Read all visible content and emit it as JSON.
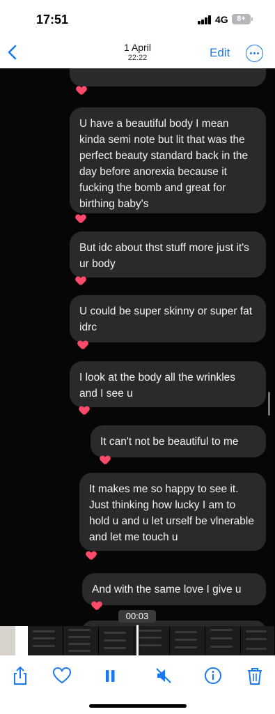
{
  "status_bar": {
    "time": "17:51",
    "network": "4G",
    "battery": "8+"
  },
  "nav": {
    "date": "1 April",
    "time": "22:22",
    "edit_label": "Edit"
  },
  "video": {
    "timecode": "00:03",
    "messages": [
      {
        "side": "left",
        "text": "U have a beautiful body I mean kinda semi note but lit that was the perfect beauty standard back in the day before anorexia because it fucking the bomb and great for birthing baby's",
        "reaction": "heart"
      },
      {
        "side": "left",
        "text": "But idc about thst stuff more just it's ur body",
        "reaction": "heart"
      },
      {
        "side": "left",
        "text": "U could be super skinny or super fat idrc",
        "reaction": "heart"
      },
      {
        "side": "left",
        "text": "I look at the body all the wrinkles and I see u",
        "reaction": "heart"
      },
      {
        "side": "right",
        "text": "It can't not be beautiful to me",
        "reaction": "heart"
      },
      {
        "side": "right",
        "text": "It makes me so happy to see it. Just thinking how lucky I am to hold u and u let urself be vlnerable and let me touch u",
        "reaction": "heart"
      },
      {
        "side": "right",
        "text": "And with the same love I give u",
        "reaction": "heart"
      }
    ]
  },
  "toolbar": {
    "icons": [
      "share-icon",
      "heart-icon",
      "pause-icon",
      "mute-icon",
      "info-icon",
      "trash-icon"
    ]
  },
  "colors": {
    "accent": "#1a78f0",
    "bubble": "#2a2a2c",
    "reaction": "#ff4a6a",
    "video_bg": "#050505"
  }
}
